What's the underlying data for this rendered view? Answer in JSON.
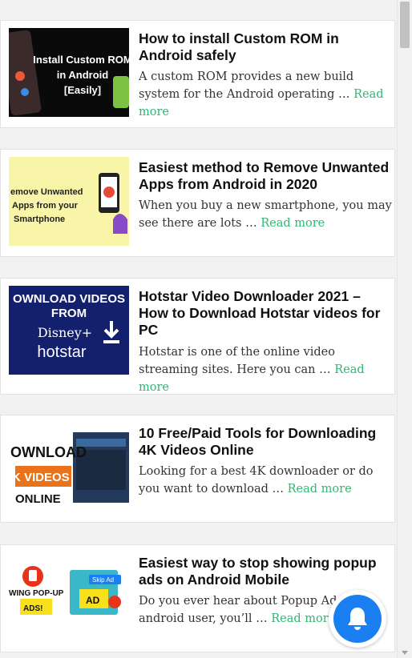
{
  "read_more_label": "Read more",
  "accent_color": "#2eb872",
  "notification_icon": "bell-icon",
  "articles": [
    {
      "title": "How to install Custom ROM in Android safely",
      "excerpt": "A custom ROM provides a new build system for the Android operating …",
      "thumb_lines": [
        "Install Custom ROM",
        "in Android",
        "[Easily]"
      ]
    },
    {
      "title": "Easiest method to Remove Unwanted Apps from Android in 2020",
      "excerpt": "When you buy a new smartphone, you may see there are lots …",
      "thumb_lines": [
        "emove Unwanted",
        "Apps from your",
        "Smartphone"
      ]
    },
    {
      "title": "Hotstar Video Downloader 2021 – How to Download Hotstar videos for PC",
      "excerpt": "Hotstar is one of the online video streaming sites. Here you can …",
      "thumb_lines": [
        "OWNLOAD VIDEOS",
        "FROM",
        "Disney+",
        "hotstar"
      ]
    },
    {
      "title": "10 Free/Paid Tools for Downloading 4K Videos Online",
      "excerpt": "Looking for a best 4K downloader or do you want to download …",
      "thumb_lines": [
        "OWNLOAD",
        "K VIDEOS",
        "ONLINE"
      ]
    },
    {
      "title": "Easiest way to stop showing popup ads on Android Mobile",
      "excerpt": "Do you ever hear about Popup Ads? android user, you’ll …",
      "thumb_lines": [
        "WING POP-UP",
        "ADS!",
        "AD",
        "Skip Ad"
      ]
    }
  ]
}
